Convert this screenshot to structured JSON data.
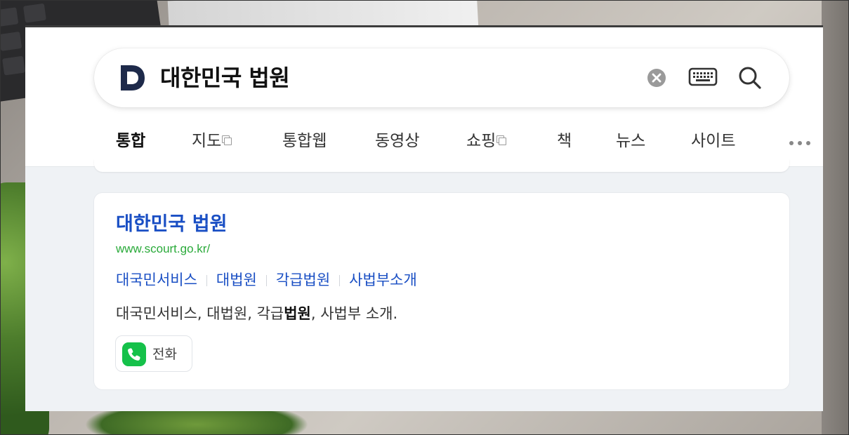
{
  "search": {
    "logo_letter": "D",
    "query": "대한민국 법원"
  },
  "tabs": [
    {
      "label": "통합",
      "active": true,
      "external": false
    },
    {
      "label": "지도",
      "active": false,
      "external": true
    },
    {
      "label": "통합웹",
      "active": false,
      "external": false
    },
    {
      "label": "동영상",
      "active": false,
      "external": false
    },
    {
      "label": "쇼핑",
      "active": false,
      "external": true
    },
    {
      "label": "책",
      "active": false,
      "external": false
    },
    {
      "label": "뉴스",
      "active": false,
      "external": false
    },
    {
      "label": "사이트",
      "active": false,
      "external": false
    }
  ],
  "result": {
    "title": "대한민국 법원",
    "url": "www.scourt.go.kr/",
    "sitelinks": [
      "대국민서비스",
      "대법원",
      "각급법원",
      "사법부소개"
    ],
    "description": {
      "before": "대국민서비스, 대법원, 각급",
      "highlight": "법원",
      "after": ", 사법부 소개."
    },
    "call_label": "전화"
  },
  "icons": {
    "clear": "clear-icon",
    "keyboard": "keyboard-icon",
    "search": "search-icon",
    "more": "more-icon",
    "phone": "phone-icon"
  },
  "colors": {
    "brand": "#1e2a4a",
    "link": "#1a4fc4",
    "url": "#2aaa3a",
    "call": "#15c14a"
  }
}
